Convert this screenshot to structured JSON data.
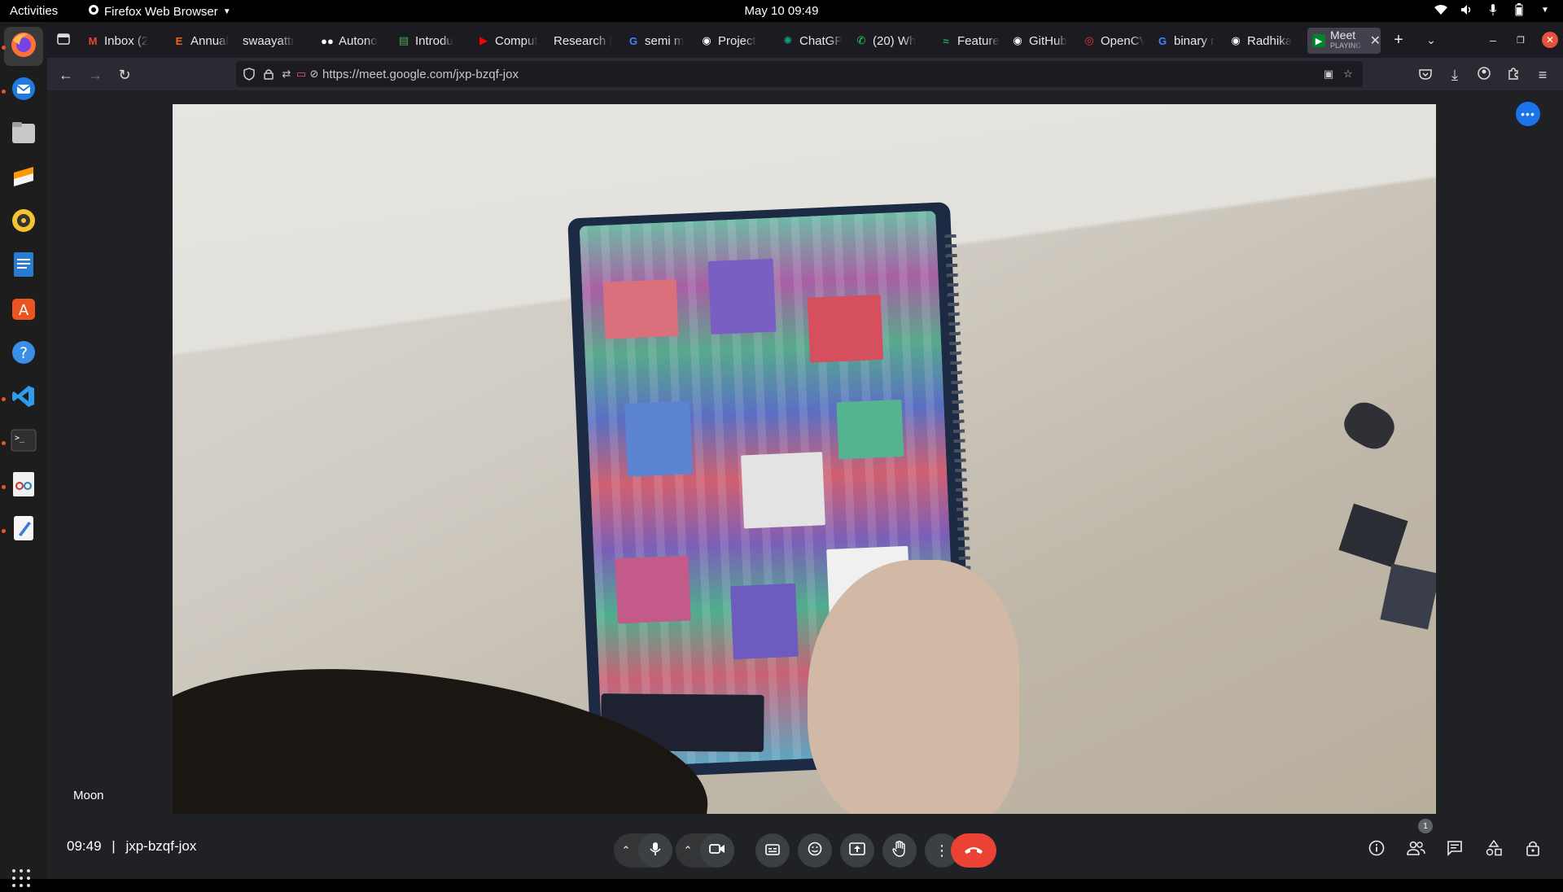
{
  "topbar": {
    "activities": "Activities",
    "app_name": "Firefox Web Browser",
    "clock": "May 10  09:49"
  },
  "dock": {
    "apps": [
      "firefox",
      "thunderbird",
      "files",
      "sublime",
      "rhythmbox",
      "writer",
      "app-center",
      "help",
      "vscode",
      "terminal",
      "image-viewer",
      "text-editor"
    ],
    "show_apps": "show-applications"
  },
  "browser": {
    "tabs": [
      {
        "label": "Inbox (2",
        "icon": "gmail-icon",
        "color": "#ea4335"
      },
      {
        "label": "Annual",
        "icon": "etsy-icon",
        "color": "#f1641e"
      },
      {
        "label": "swaayattr",
        "icon": "",
        "color": ""
      },
      {
        "label": "Autono",
        "icon": "medium-icon",
        "color": "#ffffff"
      },
      {
        "label": "Introdu",
        "icon": "doc-icon",
        "color": "#4caf50"
      },
      {
        "label": "Comput",
        "icon": "youtube-icon",
        "color": "#ff0000"
      },
      {
        "label": "Research |",
        "icon": "",
        "color": ""
      },
      {
        "label": "semi m",
        "icon": "google-icon",
        "color": "#4285f4"
      },
      {
        "label": "Project",
        "icon": "github-icon",
        "color": "#ffffff"
      },
      {
        "label": "ChatGP",
        "icon": "chatgpt-icon",
        "color": "#10a37f"
      },
      {
        "label": "(20) Wh",
        "icon": "whatsapp-icon",
        "color": "#25d366"
      },
      {
        "label": "Feature",
        "icon": "feature-icon",
        "color": "#2ea44f"
      },
      {
        "label": "GitHub",
        "icon": "github-icon",
        "color": "#ffffff"
      },
      {
        "label": "OpenCV",
        "icon": "opencv-icon",
        "color": "#e53935"
      },
      {
        "label": "binary r",
        "icon": "google-icon",
        "color": "#4285f4"
      },
      {
        "label": "Radhika",
        "icon": "github-icon",
        "color": "#ffffff"
      }
    ],
    "active_tab": {
      "label": "Meet",
      "sublabel": "PLAYING",
      "icon": "meet-icon"
    },
    "new_tab": "+",
    "url": "https://meet.google.com/jxp-bzqf-jox"
  },
  "meet": {
    "participant_name": "Moon",
    "time": "09:49",
    "separator": "|",
    "meeting_code": "jxp-bzqf-jox",
    "participant_count": "1",
    "hangup_color": "#ea4335",
    "accent_color": "#1a73e8"
  }
}
